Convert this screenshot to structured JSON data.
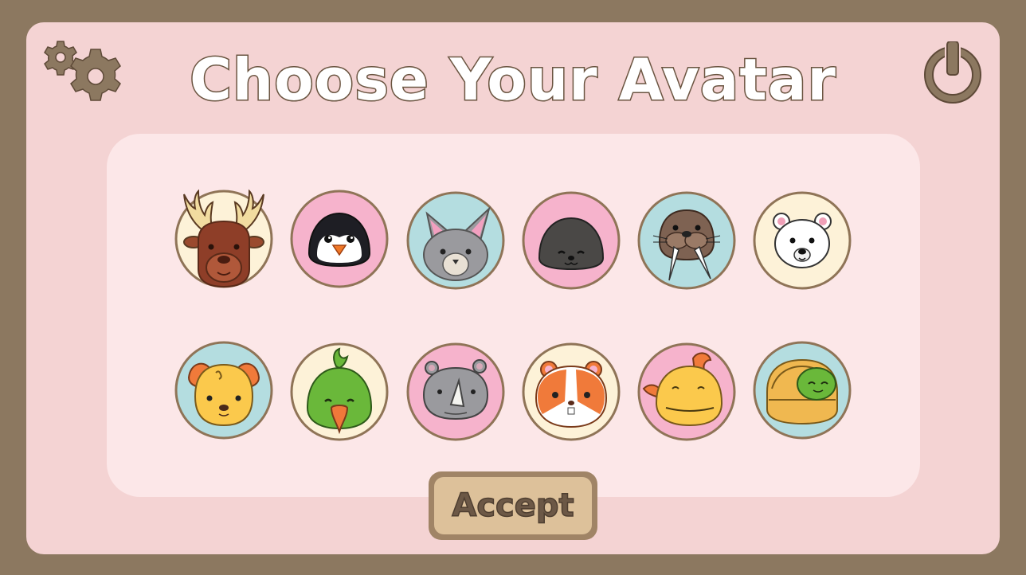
{
  "screen": {
    "title": "Choose Your Avatar",
    "accept_label": "Accept"
  },
  "icons": {
    "settings": "gear-icon",
    "power": "power-icon"
  },
  "colors": {
    "outer_border": "#8c7860",
    "frame_bg": "#f4d3d3",
    "panel_bg": "#fce7e8",
    "circle_border": "#8f7457",
    "bg_cream": "#fdf2d8",
    "bg_pink": "#f6b3cc",
    "bg_teal": "#b4dde0",
    "accept_fill": "#ddc19a",
    "accent_brown": "#8c7860"
  },
  "avatars": [
    {
      "animal": "deer",
      "bg": "cream"
    },
    {
      "animal": "penguin",
      "bg": "pink"
    },
    {
      "animal": "bat",
      "bg": "teal"
    },
    {
      "animal": "seal",
      "bg": "pink"
    },
    {
      "animal": "walrus",
      "bg": "teal"
    },
    {
      "animal": "polar-bear",
      "bg": "cream"
    },
    {
      "animal": "dog",
      "bg": "teal"
    },
    {
      "animal": "parrot",
      "bg": "cream"
    },
    {
      "animal": "rhino",
      "bg": "pink"
    },
    {
      "animal": "hamster",
      "bg": "cream"
    },
    {
      "animal": "fish",
      "bg": "pink"
    },
    {
      "animal": "turtle",
      "bg": "teal"
    }
  ]
}
